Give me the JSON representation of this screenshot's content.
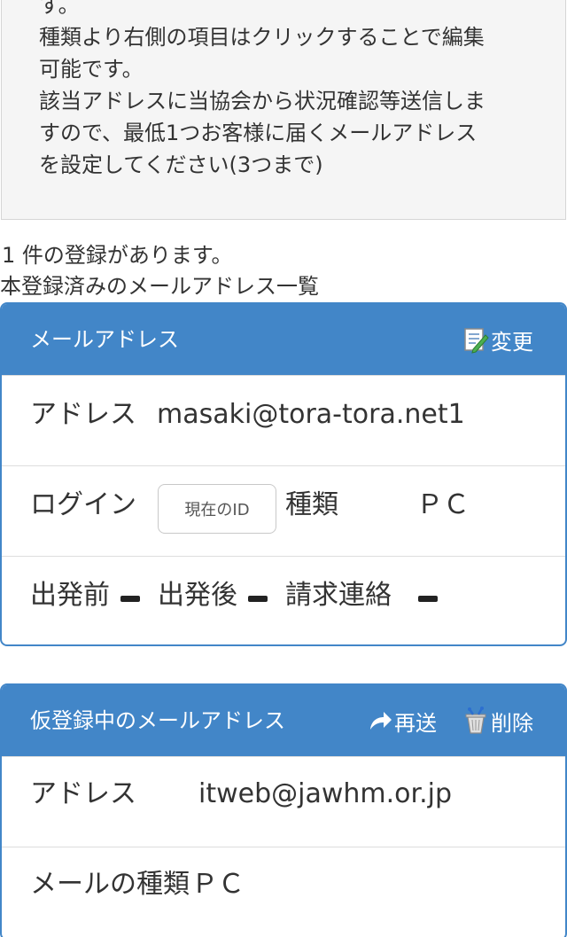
{
  "notice": {
    "lines": [
      "す。",
      "種類より右側の項目はクリックすることで編集",
      "可能です。",
      "該当アドレスに当協会から状況確認等送信しま",
      "すので、最低1つお客様に届くメールアドレス",
      "を設定してください(3つまで)"
    ]
  },
  "count_text": "1 件の登録があります。",
  "list_title": "本登録済みのメールアドレス一覧",
  "registered": {
    "header": "メールアドレス",
    "edit_label": "変更",
    "edit_icon": "edit-icon",
    "address_label": "アドレス",
    "address_value": "masaki@tora-tora.net1",
    "login_label": "ログイン",
    "login_button": "現在のID",
    "type_label": "種類",
    "type_value": "ＰＣ",
    "before_label": "出発前",
    "after_label": "出発後",
    "billing_label": "請求連絡",
    "dash_color": "#222222"
  },
  "provisional": {
    "header": "仮登録中のメールアドレス",
    "resend_label": "再送",
    "resend_icon": "share-arrow-icon",
    "delete_label": "削除",
    "delete_icon": "trash-icon",
    "address_label": "アドレス",
    "address_value": "itweb@jawhm.or.jp",
    "type_label": "メールの種類",
    "type_value": "ＰＣ"
  },
  "colors": {
    "accent": "#4286c8",
    "notice_bg": "#f5f5f5"
  }
}
